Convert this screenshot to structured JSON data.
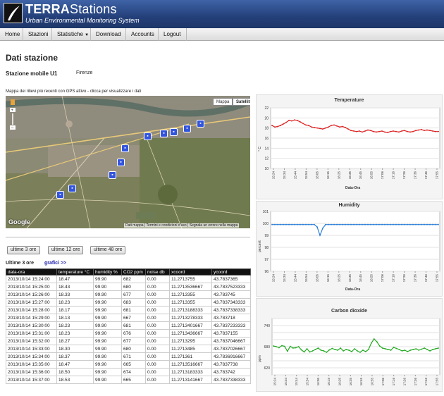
{
  "header": {
    "brand_main": "TERRA",
    "brand_rest": "Stations",
    "subtitle": "Urban Environmental Monitoring System"
  },
  "nav": [
    {
      "label": "Home"
    },
    {
      "label": "Stazioni"
    },
    {
      "label": "Statistiche"
    },
    {
      "label": "Download"
    },
    {
      "label": "Accounts"
    },
    {
      "label": "Logout"
    }
  ],
  "page": {
    "title": "Dati stazione",
    "station_name": "Stazione mobile U1",
    "station_city": "Firenze"
  },
  "map": {
    "caption": "Mappa dei rilievi più recenti con GPS attivo - clicca per visualizzare i dati",
    "btn_map": "Mappa",
    "btn_sat": "Satellite",
    "google": "Google",
    "footer": "Dati mappa  |  Termini e condizioni d'uso  |  Segnala un errore nella mappa",
    "road_labels": [
      "S5",
      "S5",
      "S5",
      "S5",
      "S67"
    ]
  },
  "range_buttons": {
    "b3": "ultime 3 ore",
    "b12": "ultime 12 ore",
    "b48": "ultime 48 ore"
  },
  "table": {
    "section_label": "Ultime 3 ore",
    "charts_link": "grafici >>",
    "columns": [
      "data-ora",
      "temperature °C",
      "humidity %",
      "CO2 ppm",
      "noise db",
      "xcoord",
      "ycoord"
    ],
    "rows": [
      [
        "2013/10/14 15:24:00",
        "18.47",
        "99.90",
        "682",
        "0.00",
        "11.2713755",
        "43.7837365"
      ],
      [
        "2013/10/14 15:25:00",
        "18.43",
        "99.90",
        "680",
        "0.00",
        "11.2713536667",
        "43.7837523333"
      ],
      [
        "2013/10/14 15:26:00",
        "18.33",
        "99.90",
        "677",
        "0.00",
        "11.2713355",
        "43.783745"
      ],
      [
        "2013/10/14 15:27:00",
        "18.23",
        "99.90",
        "683",
        "0.00",
        "11.2713355",
        "43.7837343333"
      ],
      [
        "2013/10/14 15:28:00",
        "18.17",
        "99.90",
        "681",
        "0.00",
        "11.2713188333",
        "43.7837338333"
      ],
      [
        "2013/10/14 15:29:00",
        "18.13",
        "99.90",
        "667",
        "0.00",
        "11.2713278333",
        "43.783718"
      ],
      [
        "2013/10/14 15:30:00",
        "18.23",
        "99.90",
        "681",
        "0.00",
        "11.2713401667",
        "43.7837233333"
      ],
      [
        "2013/10/14 15:31:00",
        "18.23",
        "99.90",
        "676",
        "0.00",
        "11.2713436667",
        "43.7837155"
      ],
      [
        "2013/10/14 15:32:00",
        "18.27",
        "99.90",
        "677",
        "0.00",
        "11.2713295",
        "43.7837046667"
      ],
      [
        "2013/10/14 15:33:00",
        "18.30",
        "99.90",
        "680",
        "0.00",
        "11.2713485",
        "43.7837026667"
      ],
      [
        "2013/10/14 15:34:00",
        "18.37",
        "99.90",
        "671",
        "0.00",
        "11.271361",
        "43.7836916667"
      ],
      [
        "2013/10/14 15:35:00",
        "18.47",
        "99.90",
        "665",
        "0.00",
        "11.2713516667",
        "43.7837738"
      ],
      [
        "2013/10/14 15:36:00",
        "18.50",
        "99.90",
        "674",
        "0.00",
        "11.2713183333",
        "43.783742"
      ],
      [
        "2013/10/14 15:37:00",
        "18.53",
        "99.90",
        "665",
        "0.00",
        "11.2713141667",
        "43.7837338333"
      ]
    ]
  },
  "colors": {
    "temperature": "#dd2222",
    "humidity": "#2b7fd8",
    "co2": "#22aa22"
  },
  "chart_data": [
    {
      "type": "line",
      "title": "Temperature",
      "xlabel": "Data-Ora",
      "ylabel": "° C",
      "ylim": [
        10,
        22
      ],
      "yticks": [
        "10",
        "12",
        "14",
        "16",
        "18",
        "20",
        "22"
      ],
      "x": [
        "15:24",
        "15:34",
        "15:44",
        "15:54",
        "16:05",
        "16:15",
        "16:25",
        "16:35",
        "16:45",
        "16:55",
        "17:06",
        "17:16",
        "17:26",
        "17:36",
        "17:46",
        "17:55"
      ],
      "values": [
        18.5,
        18.2,
        18.3,
        18.5,
        18.8,
        19.1,
        19.5,
        19.4,
        19.6,
        19.5,
        19.2,
        18.9,
        18.6,
        18.5,
        18.2,
        18.1,
        18.0,
        17.9,
        17.8,
        18.0,
        18.2,
        18.5,
        18.6,
        18.4,
        18.2,
        18.3,
        18.1,
        17.8,
        17.5,
        17.4,
        17.3,
        17.4,
        17.2,
        17.4,
        17.6,
        17.5,
        17.3,
        17.2,
        17.3,
        17.4,
        17.2,
        17.1,
        17.3,
        17.4,
        17.3,
        17.2,
        17.4,
        17.5,
        17.3,
        17.2,
        17.3,
        17.5,
        17.6,
        17.7,
        17.5,
        17.6,
        17.5,
        17.4,
        17.3,
        17.3
      ]
    },
    {
      "type": "line",
      "title": "Humidity",
      "xlabel": "Data-Ora",
      "ylabel": "percent",
      "ylim": [
        96,
        101
      ],
      "yticks": [
        "96",
        "97",
        "98",
        "99",
        "100",
        "101"
      ],
      "x": [
        "15:24",
        "15:34",
        "15:44",
        "15:54",
        "16:05",
        "16:15",
        "16:25",
        "16:35",
        "16:45",
        "16:55",
        "17:06",
        "17:16",
        "17:26",
        "17:36",
        "17:46",
        "17:55"
      ],
      "values": [
        99.9,
        99.9,
        99.9,
        99.9,
        99.9,
        99.9,
        99.9,
        99.9,
        99.9,
        99.9,
        99.9,
        99.9,
        99.9,
        99.9,
        99.9,
        99.9,
        99.7,
        99.0,
        99.6,
        99.9,
        99.9,
        99.9,
        99.9,
        99.9,
        99.9,
        99.9,
        99.9,
        99.9,
        99.9,
        99.9,
        99.9,
        99.9,
        99.9,
        99.9,
        99.9,
        99.9,
        99.9,
        99.9,
        99.9,
        99.9,
        99.9,
        99.9,
        99.9,
        99.9,
        99.9,
        99.9,
        99.9,
        99.9,
        99.9,
        99.9,
        99.9,
        99.9,
        99.9,
        99.9,
        99.9,
        99.9,
        99.9,
        99.9,
        99.9,
        99.9
      ]
    },
    {
      "type": "line",
      "title": "Carbon dioxide",
      "xlabel": "Data-Ora",
      "ylabel": "ppm",
      "ylim": [
        600,
        760
      ],
      "yticks": [
        "600",
        "620",
        "640",
        "660",
        "680",
        "700",
        "720",
        "740",
        "760"
      ],
      "ytick_labels_shown": [
        "620",
        "680",
        "740"
      ],
      "x": [
        "15:24",
        "15:34",
        "15:44",
        "15:54",
        "16:05",
        "16:15",
        "16:25",
        "16:35",
        "16:45",
        "16:55",
        "17:06",
        "17:16",
        "17:26",
        "17:36",
        "17:46",
        "17:55"
      ],
      "values": [
        682,
        680,
        677,
        683,
        681,
        667,
        681,
        676,
        677,
        680,
        671,
        665,
        674,
        665,
        668,
        672,
        676,
        670,
        668,
        664,
        671,
        675,
        672,
        670,
        676,
        668,
        672,
        670,
        666,
        674,
        668,
        664,
        670,
        666,
        672,
        690,
        702,
        694,
        682,
        676,
        674,
        672,
        670,
        678,
        675,
        672,
        668,
        670,
        666,
        670,
        672,
        674,
        670,
        673,
        676,
        672,
        668,
        672,
        674,
        676
      ]
    }
  ]
}
